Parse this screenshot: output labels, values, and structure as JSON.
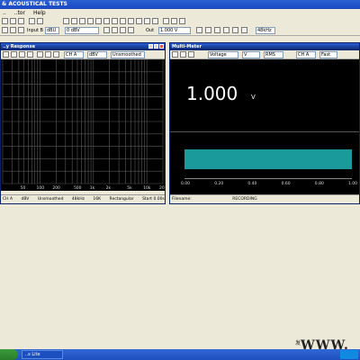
{
  "app": {
    "title": "& ACOUSTICAL TESTS"
  },
  "menu": [
    "..",
    "..tor",
    "Help"
  ],
  "toolbar": {
    "input_label": "Input B",
    "unit1": "dBU",
    "level_value": "0 dBV",
    "out_label": "Out",
    "out_value": "1.000 V",
    "freq_value": "48kHz"
  },
  "freq_window": {
    "title": "..y Response",
    "channel": "CH A",
    "unit": "dBV",
    "smoothing": "Unsmoothed",
    "x_ticks": [
      "50",
      "100",
      "200",
      "500",
      "1k",
      "2k",
      "5k",
      "10k",
      "20k"
    ],
    "status": [
      "CH A",
      "dBV",
      "Unsmoothed",
      "48kHz",
      "16K",
      "Rectangular",
      "Start 0.00s"
    ]
  },
  "meter_window": {
    "title": "Multi-Meter",
    "mode": "Voltage",
    "unit_sel": "V",
    "rms": "RMS",
    "channel": "CH A",
    "speed": "Fast",
    "reading": "1.000",
    "reading_unit": "V",
    "scale_ticks": [
      "0.00",
      "0.20",
      "0.40",
      "0.60",
      "0.80",
      "1.00"
    ],
    "bar_fraction": 1.0,
    "bar_color": "#1a9a9a",
    "status_file": "Filename:",
    "status_mode": "RECORDING"
  },
  "taskbar": {
    "item": "..s Lite"
  },
  "watermark": {
    "text": "WWW.",
    "prefix": "发"
  }
}
